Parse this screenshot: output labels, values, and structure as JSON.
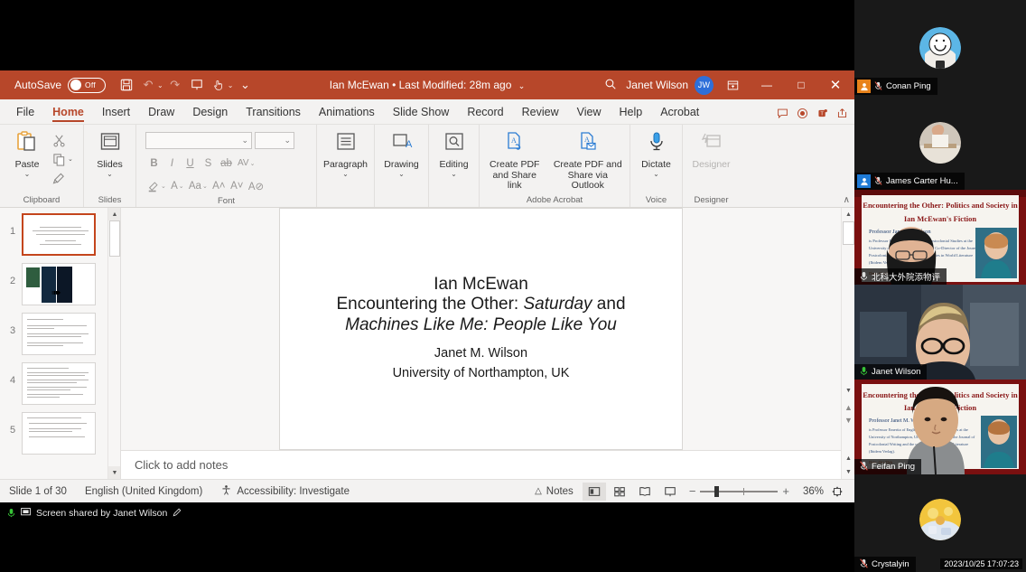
{
  "app": {
    "titlebar": {
      "autosave_label": "AutoSave",
      "autosave_state": "Off",
      "document_title": "Ian McEwan • Last Modified: 28m ago",
      "user_name": "Janet Wilson",
      "avatar_initials": "JW",
      "accent_color": "#b7472a",
      "quick_access": [
        {
          "name": "save-icon",
          "glyph": "὚B"
        },
        {
          "name": "undo-icon",
          "glyph": "↶"
        },
        {
          "name": "redo-icon",
          "glyph": "↷"
        },
        {
          "name": "start-presentation-icon",
          "glyph": "⬚"
        },
        {
          "name": "touch-mode-icon",
          "glyph": "☝"
        },
        {
          "name": "customize-qat-icon",
          "glyph": "⌄"
        }
      ],
      "window_controls": [
        {
          "name": "restore-down-icon",
          "glyph": "❐"
        },
        {
          "name": "minimize-icon",
          "glyph": "—"
        },
        {
          "name": "maximize-icon",
          "glyph": "□"
        },
        {
          "name": "close-icon",
          "glyph": "✕"
        }
      ],
      "search_icon": "⌕"
    },
    "tabs": [
      {
        "label": "File",
        "active": false
      },
      {
        "label": "Home",
        "active": true
      },
      {
        "label": "Insert",
        "active": false
      },
      {
        "label": "Draw",
        "active": false
      },
      {
        "label": "Design",
        "active": false
      },
      {
        "label": "Transitions",
        "active": false
      },
      {
        "label": "Animations",
        "active": false
      },
      {
        "label": "Slide Show",
        "active": false
      },
      {
        "label": "Record",
        "active": false
      },
      {
        "label": "Review",
        "active": false
      },
      {
        "label": "View",
        "active": false
      },
      {
        "label": "Help",
        "active": false
      },
      {
        "label": "Acrobat",
        "active": false
      }
    ],
    "tab_icons": [
      {
        "name": "comments-icon",
        "glyph": "὞9"
      },
      {
        "name": "record-icon",
        "glyph": "◉"
      },
      {
        "name": "teams-icon",
        "glyph": "T"
      },
      {
        "name": "share-icon",
        "glyph": "↪"
      }
    ],
    "ribbon": {
      "clipboard": {
        "label": "Clipboard",
        "paste_label": "Paste",
        "cut_label": "✂",
        "copy_label": "❐",
        "format_painter_label": "὘C"
      },
      "slides": {
        "label": "Slides",
        "button_label": "Slides"
      },
      "font": {
        "label": "Font",
        "font_name_value": "",
        "font_size_value": "",
        "buttons": [
          "B",
          "I",
          "U",
          "S",
          "ab",
          "AV",
          "✎",
          "A",
          "Aa",
          "A˄",
          "A˅",
          "A⊘"
        ]
      },
      "paragraph": {
        "label": "Paragraph",
        "button_label": "Paragraph"
      },
      "drawing": {
        "label": "Drawing",
        "button_label": "Drawing"
      },
      "editing": {
        "label": "Editing",
        "button_label": "Editing"
      },
      "acrobat": {
        "label": "Adobe Acrobat",
        "create_share_link": "Create PDF and Share link",
        "create_share_outlook": "Create PDF and Share via Outlook"
      },
      "voice": {
        "label": "Voice",
        "button_label": "Dictate"
      },
      "designer": {
        "label": "Designer",
        "button_label": "Designer"
      },
      "collapse_icon": "∧"
    },
    "thumbnails": [
      {
        "number": "1",
        "selected": true,
        "kind": "title"
      },
      {
        "number": "2",
        "selected": false,
        "kind": "books"
      },
      {
        "number": "3",
        "selected": false,
        "kind": "text"
      },
      {
        "number": "4",
        "selected": false,
        "kind": "text"
      },
      {
        "number": "5",
        "selected": false,
        "kind": "text"
      }
    ],
    "slide": {
      "title_line1": "Ian McEwan",
      "title_line2_pre": "Encountering the Other: ",
      "title_line2_italic": "Saturday",
      "title_line2_post": " and",
      "title_line3_italic": "Machines Like Me: People Like You",
      "author": "Janet M. Wilson",
      "affiliation": "University of Northampton, UK"
    },
    "notes_placeholder": "Click to add notes",
    "statusbar": {
      "slide_counter": "Slide 1 of 30",
      "language": "English (United Kingdom)",
      "accessibility": "Accessibility: Investigate",
      "accessibility_icon": "♿",
      "notes_label": "Notes",
      "notes_icon": "⌃",
      "views": [
        {
          "name": "normal-view-button",
          "glyph": "▤",
          "active": true
        },
        {
          "name": "slide-sorter-button",
          "glyph": "☷",
          "active": false
        },
        {
          "name": "reading-view-button",
          "glyph": "Ὅ6",
          "active": false
        },
        {
          "name": "slide-show-button",
          "glyph": "⬚",
          "active": false
        }
      ],
      "zoom_out_icon": "−",
      "zoom_in_icon": "+",
      "zoom_value": "36%",
      "fit_icon": "⧉"
    },
    "sharebar": {
      "mic_icon": "Ἲ4",
      "screen_icon": "▣",
      "text": "Screen shared by Janet Wilson",
      "pen_icon": "✐"
    }
  },
  "meeting": {
    "timestamp": "2023/10/25 17:07:23",
    "participants": [
      {
        "name": "Conan Ping",
        "badge_color": "#e8821a",
        "badge_glyph": "☻",
        "mic": "muted",
        "video": false,
        "speaking": false,
        "avatar_kind": "cartoon"
      },
      {
        "name": "James Carter Hu...",
        "badge_color": "#1e7ad6",
        "badge_glyph": "☻",
        "mic": "muted",
        "video": false,
        "speaking": false,
        "avatar_kind": "desk"
      },
      {
        "name": "北科大外院添物评",
        "badge_color": "",
        "badge_glyph": "",
        "mic": "muted",
        "video": true,
        "speaking": false,
        "avatar_kind": "poster-woman"
      },
      {
        "name": "Janet Wilson",
        "badge_color": "",
        "badge_glyph": "",
        "mic": "active",
        "video": true,
        "speaking": true,
        "avatar_kind": "webcam-woman"
      },
      {
        "name": "Feifan Ping",
        "badge_color": "",
        "badge_glyph": "",
        "mic": "muted",
        "video": true,
        "speaking": false,
        "avatar_kind": "poster-man"
      },
      {
        "name": "Crystalyin",
        "badge_color": "",
        "badge_glyph": "",
        "mic": "muted",
        "video": false,
        "speaking": false,
        "avatar_kind": "yellow-art"
      }
    ],
    "poster": {
      "title_line1": "Encountering the Other: Politics and Society in",
      "title_line2": "Ian McEwan's Fiction",
      "speaker": "Professor Janet M. Wilson"
    }
  }
}
